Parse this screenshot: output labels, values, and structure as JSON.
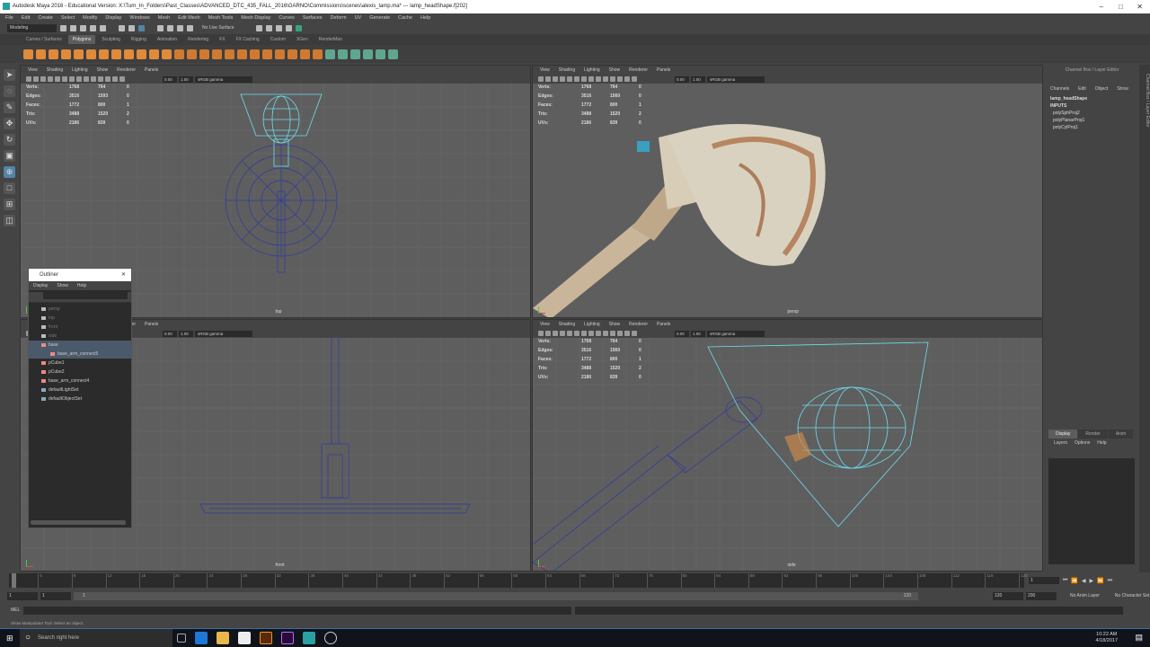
{
  "window": {
    "title": "Autodesk Maya 2016 - Educational Version: X:\\Turn_In_Folders\\Past_Classes\\ADVANCED_DTC_435_FALL_2016\\GARNO\\Commissions\\scenes\\alexis_lamp.ma*  ---  lamp_headShape.f[202]"
  },
  "menubar": [
    "File",
    "Edit",
    "Create",
    "Select",
    "Modify",
    "Display",
    "Windows",
    "Mesh",
    "Edit Mesh",
    "Mesh Tools",
    "Mesh Display",
    "Curves",
    "Surfaces",
    "Deform",
    "UV",
    "Generate",
    "Cache",
    "Help"
  ],
  "statusline": {
    "mode": "Modeling",
    "live_surface": "No Live Surface"
  },
  "shelf_tabs": [
    {
      "label": "Curves / Surfaces",
      "active": false
    },
    {
      "label": "Polygons",
      "active": true
    },
    {
      "label": "Sculpting",
      "active": false
    },
    {
      "label": "Rigging",
      "active": false
    },
    {
      "label": "Animation",
      "active": false
    },
    {
      "label": "Rendering",
      "active": false
    },
    {
      "label": "FX",
      "active": false
    },
    {
      "label": "FX Caching",
      "active": false
    },
    {
      "label": "Custom",
      "active": false
    },
    {
      "label": "XGen",
      "active": false
    },
    {
      "label": "RenderMan",
      "active": false
    }
  ],
  "viewport_menu": [
    "View",
    "Shading",
    "Lighting",
    "Show",
    "Renderer",
    "Panels"
  ],
  "viewport_toolbar": {
    "exposure": "0.00",
    "gamma": "1.00",
    "color_space": "sRGB gamma"
  },
  "stat_labels": [
    "Verts:",
    "Edges:",
    "Faces:",
    "Tris:",
    "UVs:"
  ],
  "viewports": [
    {
      "name": "top",
      "stats": [
        [
          "1768",
          "764",
          "0"
        ],
        [
          "3516",
          "1593",
          "0"
        ],
        [
          "1772",
          "800",
          "1"
        ],
        [
          "3488",
          "1520",
          "2"
        ],
        [
          "2186",
          "839",
          "0"
        ]
      ]
    },
    {
      "name": "persp",
      "stats": [
        [
          "1768",
          "764",
          "0"
        ],
        [
          "3516",
          "1560",
          "0"
        ],
        [
          "1772",
          "800",
          "1"
        ],
        [
          "3488",
          "1520",
          "2"
        ],
        [
          "2186",
          "839",
          "0"
        ]
      ]
    },
    {
      "name": "front",
      "stats": null
    },
    {
      "name": "side",
      "stats": [
        [
          "1768",
          "764",
          "0"
        ],
        [
          "3516",
          "1560",
          "0"
        ],
        [
          "1772",
          "800",
          "1"
        ],
        [
          "3488",
          "1520",
          "2"
        ],
        [
          "2186",
          "839",
          "0"
        ]
      ]
    }
  ],
  "outliner": {
    "title": "Outliner",
    "menu": [
      "Display",
      "Show",
      "Help"
    ],
    "items": [
      {
        "label": "persp",
        "dim": true
      },
      {
        "label": "top",
        "dim": true
      },
      {
        "label": "front",
        "dim": true
      },
      {
        "label": "side",
        "dim": true
      },
      {
        "label": "base",
        "hl": true
      },
      {
        "label": "base_arm_connect5",
        "hl": true
      },
      {
        "label": "pCube1"
      },
      {
        "label": "pCube2"
      },
      {
        "label": "base_arm_connect4"
      },
      {
        "label": "defaultLightSet"
      },
      {
        "label": "defaultObjectSet"
      }
    ]
  },
  "channel_box": {
    "title": "Channel Box / Layer Editor",
    "tabs": [
      "Channels",
      "Edit",
      "Object",
      "Show"
    ],
    "object": "lamp_headShape",
    "inputs_label": "INPUTS",
    "inputs": [
      "polySphProj2",
      "polyPlanarProj1",
      "polyCylProj1"
    ]
  },
  "layer_editor": {
    "tabs": [
      "Display",
      "Render",
      "Anim"
    ],
    "menu": [
      "Layers",
      "Options",
      "Help"
    ]
  },
  "side_tab": "Channel Box / Layer Editor",
  "timeline": {
    "ticks": [
      "1",
      "4",
      "8",
      "12",
      "16",
      "20",
      "24",
      "28",
      "32",
      "36",
      "40",
      "44",
      "48",
      "52",
      "56",
      "60",
      "64",
      "68",
      "72",
      "76",
      "80",
      "84",
      "88",
      "92",
      "96",
      "100",
      "104",
      "108",
      "112",
      "116",
      "120"
    ],
    "current_frame": "1"
  },
  "range": {
    "start": "1",
    "anim_start": "1",
    "slider_start": "1",
    "slider_end": "120",
    "end": "120",
    "anim_end": "200",
    "anim_layer": "No Anim Layer",
    "character_set": "No Character Set"
  },
  "command_line": {
    "label": "MEL"
  },
  "help_line": "Show Manipulator Tool: Select an object.",
  "taskbar": {
    "search_placeholder": "Search right here",
    "time": "10:22 AM",
    "date": "4/18/2017"
  }
}
